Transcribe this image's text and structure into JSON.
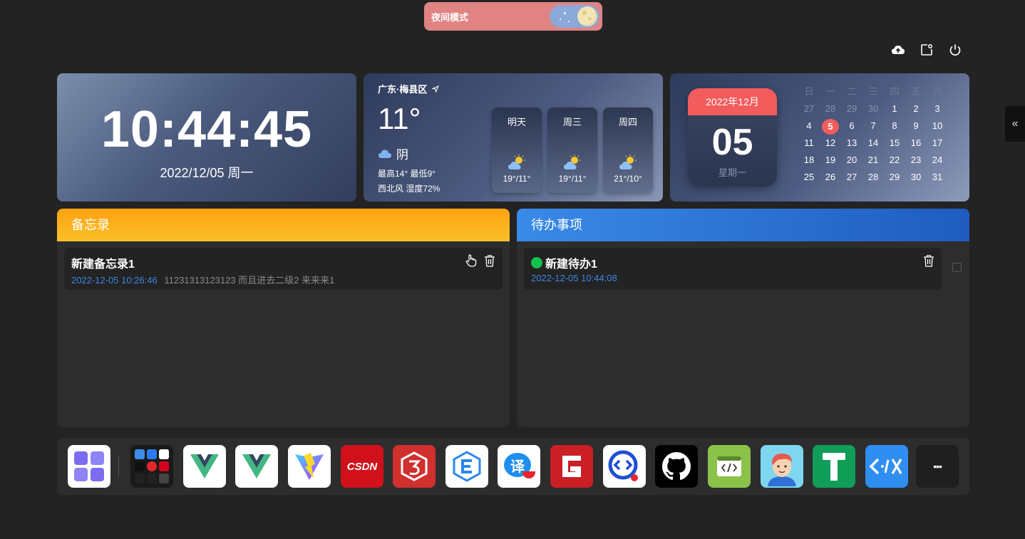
{
  "night_mode": {
    "label": "夜间模式"
  },
  "clock": {
    "time": "10:44:45",
    "date": "2022/12/05 周一"
  },
  "weather": {
    "location": "广东·梅县区",
    "temperature": "11°",
    "condition": "阴",
    "high_low": "最高14° 最低9°",
    "wind_humidity": "西北风 湿度72%",
    "forecast": [
      {
        "day": "明天",
        "temps": "19°/11°",
        "icon": "partly-cloudy-icon"
      },
      {
        "day": "周三",
        "temps": "19°/11°",
        "icon": "partly-cloudy-icon"
      },
      {
        "day": "周四",
        "temps": "21°/10°",
        "icon": "partly-cloudy-icon"
      }
    ]
  },
  "calendar": {
    "month_label": "2022年12月",
    "day": "05",
    "weekday": "星期一",
    "headers": [
      "日",
      "一",
      "二",
      "三",
      "四",
      "五",
      "六"
    ],
    "weeks": [
      [
        "27",
        "28",
        "29",
        "30",
        "1",
        "2",
        "3"
      ],
      [
        "4",
        "5",
        "6",
        "7",
        "8",
        "9",
        "10"
      ],
      [
        "11",
        "12",
        "13",
        "14",
        "15",
        "16",
        "17"
      ],
      [
        "18",
        "19",
        "20",
        "21",
        "22",
        "23",
        "24"
      ],
      [
        "25",
        "26",
        "27",
        "28",
        "29",
        "30",
        "31"
      ]
    ],
    "today": "5"
  },
  "memo": {
    "title": "备忘录",
    "items": [
      {
        "title": "新建备忘录1",
        "time": "2022-12-05 10:26:46",
        "content": "11231313123123 而且进去二级2 来来来1"
      }
    ]
  },
  "todo": {
    "title": "待办事项",
    "items": [
      {
        "title": "新建待办1",
        "time": "2022-12-05 10:44:08",
        "done": false
      }
    ]
  },
  "dock": {
    "apps": [
      "app-grid-icon",
      "app-folder-icon",
      "vue-icon",
      "vue-icon-2",
      "vite-icon",
      "csdn-icon",
      "three-js-icon",
      "edge-e-icon",
      "translate-icon",
      "g-app-icon",
      "code-circle-icon",
      "github-icon",
      "code-window-icon",
      "avatar-app-icon",
      "hammer-t-icon",
      "code-arrows-icon",
      "more-icon"
    ],
    "csdn_label": "CSDN",
    "translate_label": "译",
    "more_label": "•••"
  },
  "colors": {
    "background": "#232323",
    "panel": "#2d2d2d",
    "accent_red": "#f25c5c",
    "memo_header": "#ffa20f",
    "todo_header": "#3a8ae8",
    "link_blue": "#3e86e3",
    "todo_dot": "#12c24a"
  }
}
